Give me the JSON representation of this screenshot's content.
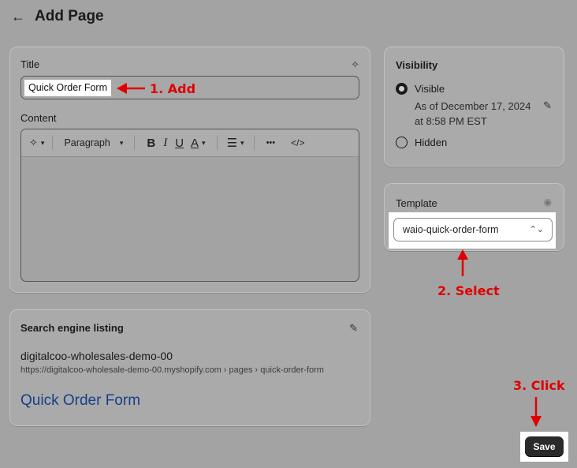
{
  "header": {
    "back_icon": "arrow-left-icon",
    "title": "Add Page"
  },
  "title_field": {
    "label": "Title",
    "value": "Quick Order Form",
    "icon": "sparkle-icon"
  },
  "content_field": {
    "label": "Content",
    "toolbar": {
      "magic_icon": "sparkle-icon",
      "format": "Paragraph",
      "bold": "B",
      "italic": "I",
      "underline": "U",
      "color": "A",
      "align_icon": "align-left-icon",
      "more": "•••",
      "code": "</>"
    }
  },
  "visibility": {
    "heading": "Visibility",
    "options": [
      "Visible",
      "Hidden"
    ],
    "selected": "Visible",
    "visible_line1": "As of December 17, 2024",
    "visible_line2": "at 8:58 PM EST"
  },
  "template": {
    "heading": "Template",
    "value": "waio-quick-order-form"
  },
  "seo": {
    "heading": "Search engine listing",
    "store_name": "digitalcoo-wholesales-demo-00",
    "url": "https://digitalcoo-wholesale-demo-00.myshopify.com › pages › quick-order-form",
    "page_title": "Quick Order Form"
  },
  "actions": {
    "save": "Save"
  },
  "annotations": {
    "step1": "1. Add",
    "step2": "2. Select",
    "step3": "3. Click",
    "color": "#e00000"
  }
}
